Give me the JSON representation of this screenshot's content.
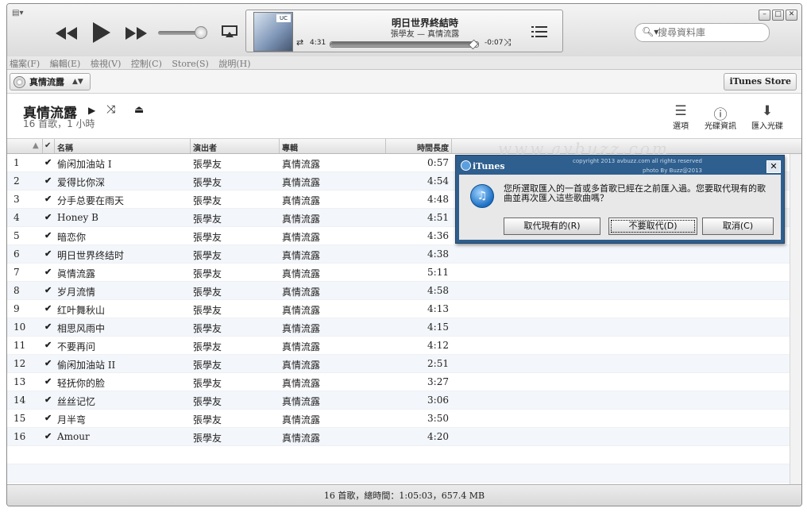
{
  "player": {
    "now_playing_title": "明日世界終結時",
    "now_playing_subtitle": "張學友 — 真情流露",
    "elapsed": "4:31",
    "remaining": "-0:07",
    "progress_fraction": 0.97,
    "volume_fraction": 0.85
  },
  "search": {
    "placeholder": "搜尋資料庫"
  },
  "menu": [
    "檔案(F)",
    "編輯(E)",
    "檢視(V)",
    "控制(C)",
    "Store(S)",
    "說明(H)"
  ],
  "source": {
    "label": "真情流露",
    "store_button": "iTunes Store"
  },
  "album": {
    "title": "真情流露",
    "summary": "16 首歌，1 小時",
    "actions": {
      "options": "選項",
      "cd_info": "光碟資訊",
      "import_cd": "匯入光碟"
    }
  },
  "table": {
    "headers": {
      "name": "名稱",
      "artist": "演出者",
      "album": "專輯",
      "time": "時間長度"
    },
    "rows": [
      {
        "num": "1",
        "check": "✔",
        "name": "偷闲加油站 I",
        "artist": "張學友",
        "album": "真情流露",
        "time": "0:57"
      },
      {
        "num": "2",
        "check": "✔",
        "name": "爱得比你深",
        "artist": "張學友",
        "album": "真情流露",
        "time": "4:54"
      },
      {
        "num": "3",
        "check": "✔",
        "name": "分手总要在雨天",
        "artist": "張學友",
        "album": "真情流露",
        "time": "4:48"
      },
      {
        "num": "4",
        "check": "✔",
        "name": "Honey B",
        "artist": "張學友",
        "album": "真情流露",
        "time": "4:51"
      },
      {
        "num": "5",
        "check": "✔",
        "name": "暗恋你",
        "artist": "張學友",
        "album": "真情流露",
        "time": "4:36"
      },
      {
        "num": "6",
        "check": "✔",
        "name": "明日世界终结时",
        "artist": "張學友",
        "album": "真情流露",
        "time": "4:38"
      },
      {
        "num": "7",
        "check": "✔",
        "name": "眞情流露",
        "artist": "張學友",
        "album": "真情流露",
        "time": "5:11"
      },
      {
        "num": "8",
        "check": "✔",
        "name": "岁月流情",
        "artist": "張學友",
        "album": "真情流露",
        "time": "4:58"
      },
      {
        "num": "9",
        "check": "✔",
        "name": "红叶舞秋山",
        "artist": "張學友",
        "album": "真情流露",
        "time": "4:13"
      },
      {
        "num": "10",
        "check": "✔",
        "name": "相思风雨中",
        "artist": "張學友",
        "album": "真情流露",
        "time": "4:15"
      },
      {
        "num": "11",
        "check": "✔",
        "name": "不要再问",
        "artist": "張學友",
        "album": "真情流露",
        "time": "4:12"
      },
      {
        "num": "12",
        "check": "✔",
        "name": "偷闲加油站 II",
        "artist": "張學友",
        "album": "真情流露",
        "time": "2:51"
      },
      {
        "num": "13",
        "check": "✔",
        "name": "轻抚你的脸",
        "artist": "張學友",
        "album": "真情流露",
        "time": "3:27"
      },
      {
        "num": "14",
        "check": "✔",
        "name": "丝丝记忆",
        "artist": "張學友",
        "album": "真情流露",
        "time": "3:06"
      },
      {
        "num": "15",
        "check": "✔",
        "name": "月半弯",
        "artist": "張學友",
        "album": "真情流露",
        "time": "3:50"
      },
      {
        "num": "16",
        "check": "✔",
        "name": "Amour",
        "artist": "張學友",
        "album": "真情流露",
        "time": "4:20"
      }
    ]
  },
  "status": "16 首歌，總時間：1:05:03，657.4 MB",
  "watermark": "www.avbuzz.com",
  "dialog": {
    "title": "iTunes",
    "copyright_line1": "copyright 2013 avbuzz.com all rights reserved",
    "copyright_line2": "photo By Buzz@2013",
    "message": "您所選取匯入的一首或多首歌已經在之前匯入過。您要取代現有的歌曲並再次匯入這些歌曲嗎？",
    "buttons": {
      "replace": "取代現有的(R)",
      "dont_replace": "不要取代(D)",
      "cancel": "取消(C)"
    }
  },
  "icons": {
    "window_menu": "window-menu-icon",
    "previous": "previous-icon",
    "play": "play-icon",
    "next": "next-icon",
    "airplay": "airplay-icon",
    "repeat": "repeat-icon",
    "shuffle": "shuffle-icon",
    "up_next": "list-icon",
    "search": "search-icon",
    "cd": "cd-icon",
    "eject": "eject-icon",
    "itunes": "itunes-icon"
  }
}
